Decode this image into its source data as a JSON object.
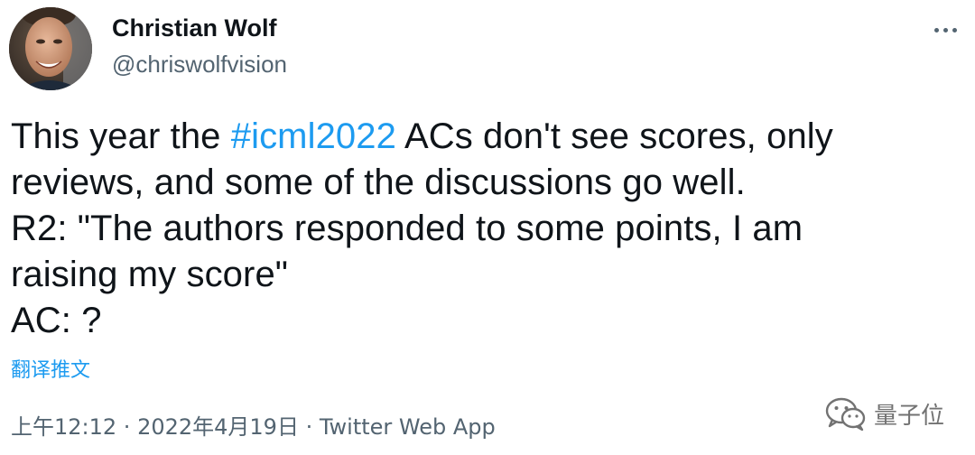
{
  "author": {
    "display_name": "Christian Wolf",
    "handle": "@chriswolfvision"
  },
  "icons": {
    "more": "more-horizontal-icon",
    "avatar": "profile-photo",
    "watermark": "wechat-icon"
  },
  "tweet": {
    "line1_before": "This year the ",
    "hashtag": "#icml2022",
    "line1_after": " ACs don't see scores, only",
    "line2": "reviews, and some of the discussions go well.",
    "line3": "R2: \"The authors responded to some points, I am",
    "line4": "raising my score\"",
    "line5": "AC: ?"
  },
  "translate_label": "翻译推文",
  "meta": {
    "time": "上午12:12",
    "separator": " · ",
    "date": "2022年4月19日",
    "source": "Twitter Web App"
  },
  "watermark": {
    "text": "量子位"
  },
  "colors": {
    "link": "#1d9bf0",
    "text": "#0f1419",
    "secondary": "#536471"
  }
}
